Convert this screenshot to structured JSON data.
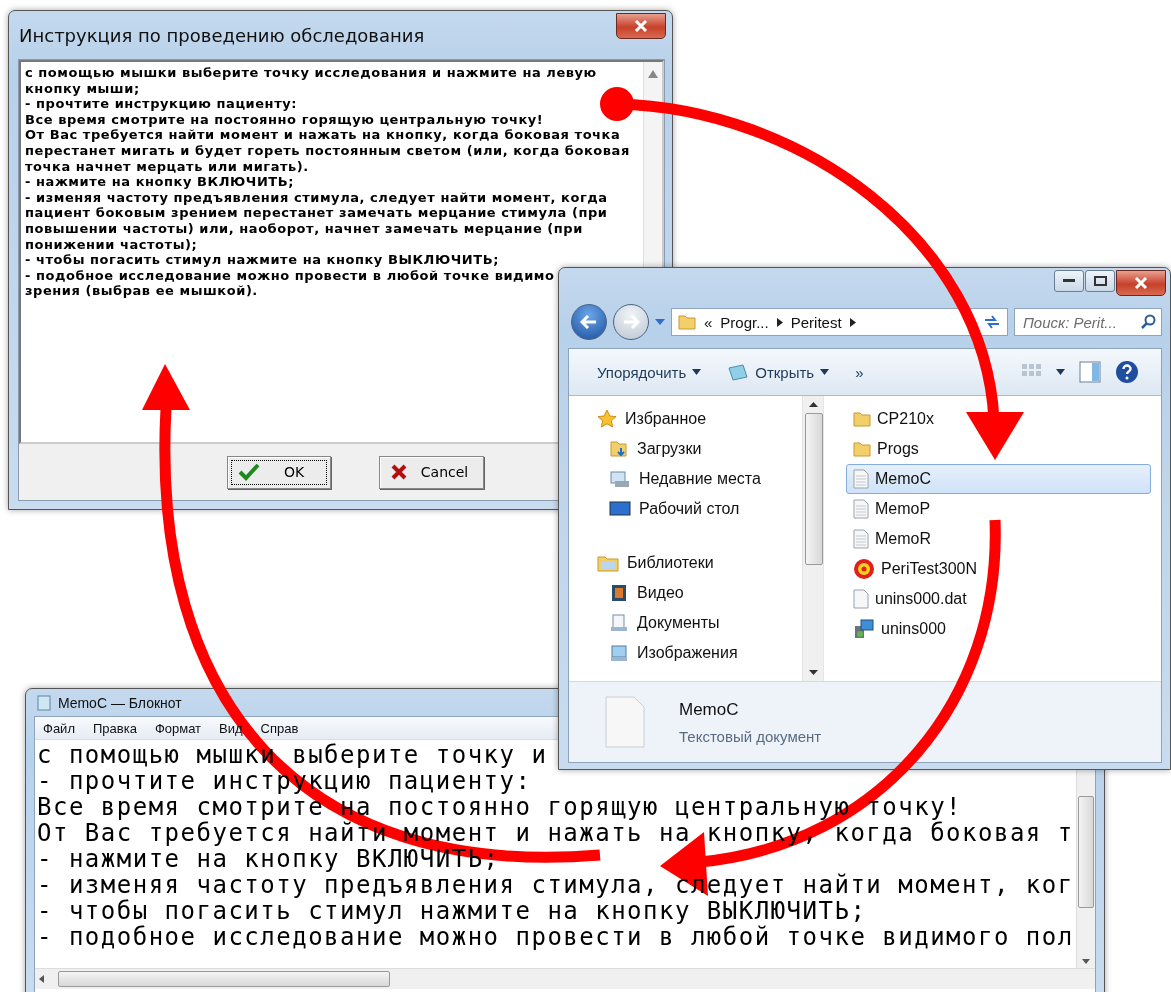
{
  "dialog": {
    "title": "Инструкция по проведению обследования",
    "text_lines": [
      "с помощью мышки выберите точку исследования и нажмите на левую",
      "кнопку мыши;",
      "- прочтите инструкцию пациенту:",
      "Все время смотрите на постоянно горящую центральную точку!",
      "От Вас требуется найти момент и нажать на кнопку, когда боковая точка",
      "перестанет мигать и будет гореть постоянным светом (или, когда боковая",
      "точка начнет мерцать или мигать).",
      "- нажмите на кнопку ВКЛЮЧИТЬ;",
      "- изменяя частоту предъявления стимула, следует найти момент, когда",
      "пациент боковым зрением перестанет замечать мерцание стимула (при",
      "повышении частоты) или, наоборот, начнет замечать мерцание (при",
      "понижении частоты);",
      "- чтобы погасить стимул нажмите на кнопку ВЫКЛЮЧИТЬ;",
      "- подобное исследование можно провести в любой точке видимо",
      "зрения (выбрав ее мышкой)."
    ],
    "buttons": [
      {
        "label": "OK",
        "kind": "ok"
      },
      {
        "label": "Cancel",
        "kind": "cancel"
      }
    ]
  },
  "explorer": {
    "address_overflow": "«",
    "address_path": [
      "Progr...",
      "Peritest"
    ],
    "search": {
      "placeholder": "Поиск: Perit..."
    },
    "toolbar": [
      {
        "label": "Упорядочить",
        "kind": "menu"
      },
      {
        "label": "Открыть",
        "kind": "open"
      }
    ],
    "toolbar_more": "»",
    "nav_groups": [
      {
        "label": "Избранное",
        "kind": "favorites",
        "children": [
          {
            "label": "Загрузки",
            "kind": "downloads"
          },
          {
            "label": "Недавние места",
            "kind": "recent"
          },
          {
            "label": "Рабочий стол",
            "kind": "desktop"
          }
        ]
      },
      {
        "label": "Библиотеки",
        "kind": "libraries",
        "children": [
          {
            "label": "Видео",
            "kind": "video"
          },
          {
            "label": "Документы",
            "kind": "documents"
          },
          {
            "label": "Изображения",
            "kind": "pictures"
          }
        ]
      }
    ],
    "files": [
      {
        "name": "CP210x",
        "kind": "folder",
        "selected": false
      },
      {
        "name": "Progs",
        "kind": "folder",
        "selected": false
      },
      {
        "name": "MemoC",
        "kind": "text",
        "selected": true
      },
      {
        "name": "MemoP",
        "kind": "text",
        "selected": false
      },
      {
        "name": "MemoR",
        "kind": "text",
        "selected": false
      },
      {
        "name": "PeriTest300N",
        "kind": "app",
        "selected": false
      },
      {
        "name": "unins000.dat",
        "kind": "data",
        "selected": false
      },
      {
        "name": "unins000",
        "kind": "installer",
        "selected": false
      }
    ],
    "details": {
      "name": "MemoC",
      "type": "Текстовый документ"
    }
  },
  "notepad": {
    "title": "MemoC — Блокнот",
    "menu": [
      "Файл",
      "Правка",
      "Формат",
      "Вид",
      "Справ"
    ],
    "lines": [
      "с помощью мышки выберите точку и",
      "- прочтите инструкцию пациенту:",
      "Все время смотрите на постоянно горящую центральную точку!",
      "От Вас требуется найти момент и нажать на кнопку, когда боковая т",
      "- нажмите на кнопку ВКЛЮЧИТЬ;",
      "- изменяя частоту предъявления стимула, следует найти момент, ког",
      "- чтобы погасить стимул нажмите на кнопку ВЫКЛЮЧИТЬ;",
      "- подобное исследование можно провести в любой точке видимого пол"
    ]
  }
}
